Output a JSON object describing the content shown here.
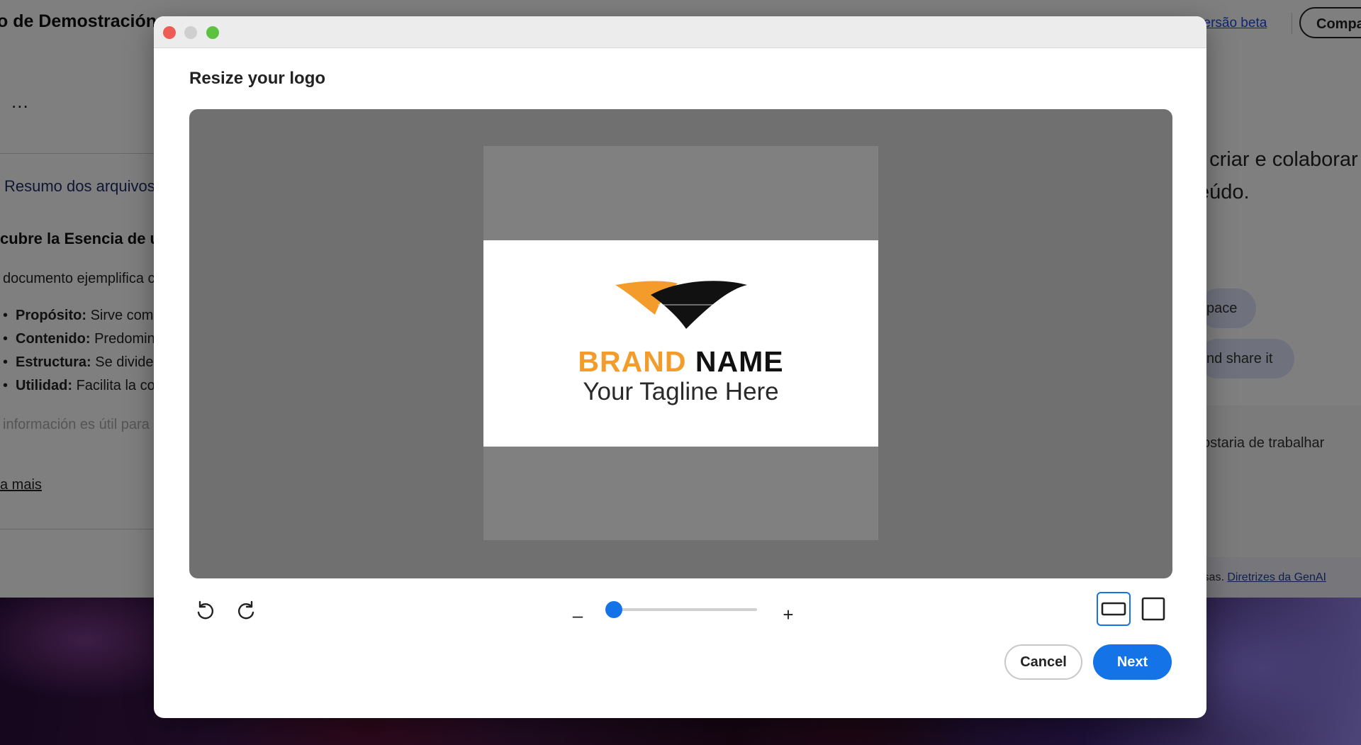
{
  "background": {
    "title": "o de Demostración",
    "more_menu": "...",
    "summary_link": "Resumo dos arquivos",
    "heading": "cubre la Esencia de u",
    "paragraph": "documento ejemplifica c",
    "bullets": [
      {
        "term": "Propósito:",
        "text": "Sirve com"
      },
      {
        "term": "Contenido:",
        "text": "Predomin"
      },
      {
        "term": "Estructura:",
        "text": "Se divide"
      },
      {
        "term": "Utilidad:",
        "text": "Facilita la co"
      }
    ],
    "faded_text": "información es útil para",
    "learn_more": "a mais",
    "beta_link": "versão beta",
    "share_button": "Compa",
    "right_line1": ", criar e colaborar",
    "right_line2": "eúdo.",
    "pill1": "pace",
    "pill2": "nd share it",
    "right_muted": "ostaria de trabalhar",
    "footer_text": "isas.",
    "footer_link": "Diretrizes da GenAI"
  },
  "modal": {
    "title": "Resize your logo",
    "logo": {
      "brand_part1": "BRAND",
      "brand_part2": "NAME",
      "tagline": "Your Tagline Here",
      "colors": {
        "orange": "#f39c2b",
        "black": "#111111"
      }
    },
    "toolbar": {
      "undo_icon": "rotate-ccw-icon",
      "redo_icon": "rotate-cw-icon",
      "zoom_minus": "–",
      "zoom_plus": "+",
      "zoom_level": 0.05,
      "aspect_options": [
        "landscape",
        "square"
      ],
      "aspect_selected": "landscape"
    },
    "buttons": {
      "cancel": "Cancel",
      "next": "Next"
    },
    "accent_color": "#1473e6"
  }
}
